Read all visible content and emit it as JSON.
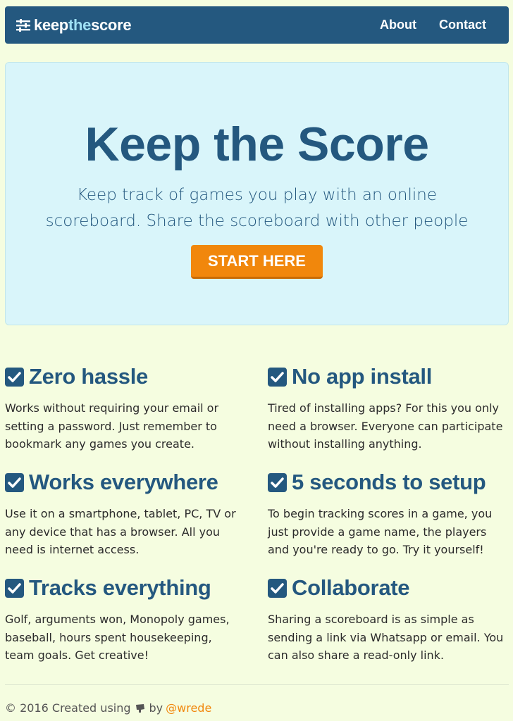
{
  "navbar": {
    "brand": {
      "part1": "keep",
      "part2": "the",
      "part3": "score"
    },
    "links": [
      "About",
      "Contact"
    ]
  },
  "hero": {
    "title": "Keep the Score",
    "line1": "Keep track of games you play with an online",
    "line2": "scoreboard. Share the scoreboard with other people",
    "button": "START HERE"
  },
  "features": [
    {
      "title": "Zero hassle",
      "body": "Works without requiring your email or setting a password. Just remember to bookmark any games you create."
    },
    {
      "title": "No app install",
      "body": "Tired of installing apps? For this you only need a browser. Everyone can participate without installing anything."
    },
    {
      "title": "Works everywhere",
      "body": "Use it on a smartphone, tablet, PC, TV or any device that has a browser. All you need is internet access."
    },
    {
      "title": "5 seconds to setup",
      "body": "To begin tracking scores in a game, you just provide a game name, the players and you're ready to go. Try it yourself!"
    },
    {
      "title": "Tracks everything",
      "body": "Golf, arguments won, Monopoly games, baseball, hours spent housekeeping, team goals. Get creative!"
    },
    {
      "title": "Collaborate",
      "body": "Sharing a scoreboard is as simple as sending a link via Whatsapp or email. You can also share a read-only link."
    }
  ],
  "footer": {
    "text": "© 2016 Created using",
    "icon": "ember-icon",
    "by": "by",
    "author": "@wrede"
  },
  "colors": {
    "primary": "#24587f",
    "accent": "#f1870c",
    "background": "#f5fde0",
    "hero": "#d9f5fa"
  }
}
